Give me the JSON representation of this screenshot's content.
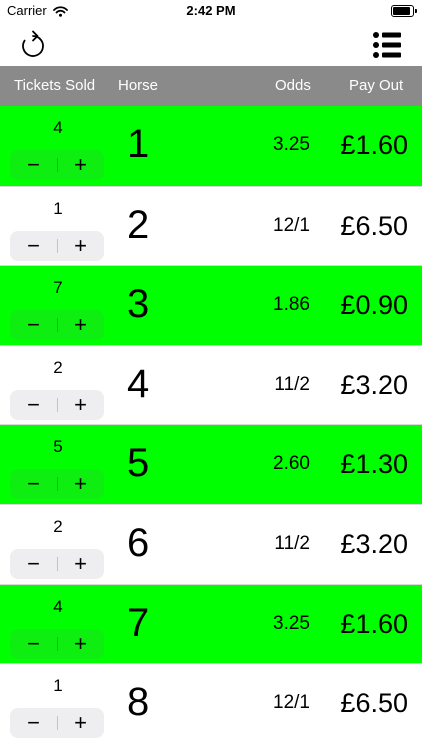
{
  "status_bar": {
    "carrier": "Carrier",
    "time": "2:42 PM"
  },
  "nav": {
    "refresh_icon": "refresh-icon",
    "list_icon": "list-icon"
  },
  "header": {
    "tickets": "Tickets Sold",
    "horse": "Horse",
    "odds": "Odds",
    "payout": "Pay Out"
  },
  "colors": {
    "highlight": "#00ff00",
    "header_bg": "#8a8a8a"
  },
  "stepper": {
    "minus": "−",
    "plus": "+"
  },
  "rows": [
    {
      "tickets": "4",
      "horse": "1",
      "odds": "3.25",
      "payout": "£1.60",
      "highlighted": true
    },
    {
      "tickets": "1",
      "horse": "2",
      "odds": "12/1",
      "payout": "£6.50",
      "highlighted": false
    },
    {
      "tickets": "7",
      "horse": "3",
      "odds": "1.86",
      "payout": "£0.90",
      "highlighted": true
    },
    {
      "tickets": "2",
      "horse": "4",
      "odds": "11/2",
      "payout": "£3.20",
      "highlighted": false
    },
    {
      "tickets": "5",
      "horse": "5",
      "odds": "2.60",
      "payout": "£1.30",
      "highlighted": true
    },
    {
      "tickets": "2",
      "horse": "6",
      "odds": "11/2",
      "payout": "£3.20",
      "highlighted": false
    },
    {
      "tickets": "4",
      "horse": "7",
      "odds": "3.25",
      "payout": "£1.60",
      "highlighted": true
    },
    {
      "tickets": "1",
      "horse": "8",
      "odds": "12/1",
      "payout": "£6.50",
      "highlighted": false
    }
  ]
}
